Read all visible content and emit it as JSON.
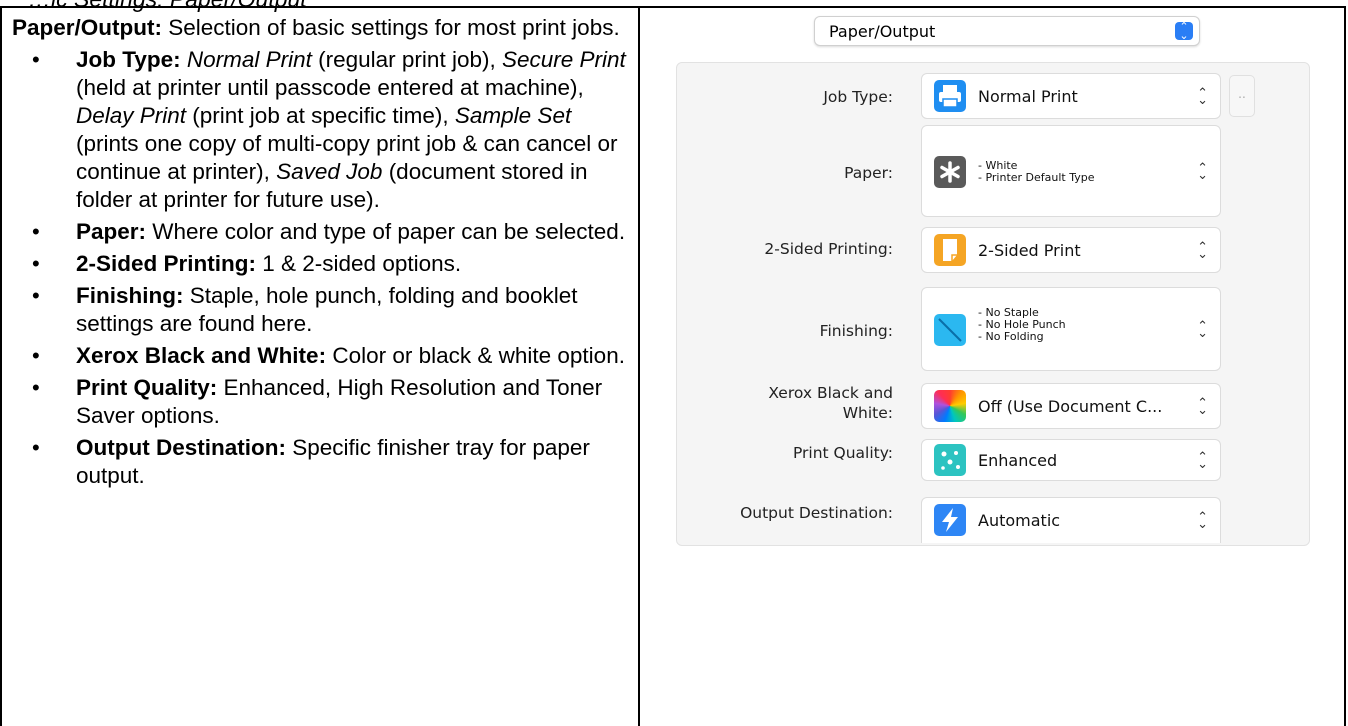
{
  "heading_fragment": "…ic Settings: Paper/Output",
  "left": {
    "intro_bold": "Paper/Output:",
    "intro_text": " Selection of basic settings for most print jobs.",
    "bullets": [
      {
        "term": "Job Type:",
        "parts": [
          {
            "i": "Normal Print"
          },
          {
            "t": " (regular print job), "
          },
          {
            "i": "Secure Print"
          },
          {
            "t": " (held at printer until passcode entered at machine), "
          },
          {
            "i": "Delay Print"
          },
          {
            "t": " (print job at specific time), "
          },
          {
            "i": "Sample Set"
          },
          {
            "t": " (prints one copy of multi-copy print job & can cancel or continue at printer), "
          },
          {
            "i": "Saved Job"
          },
          {
            "t": " (document stored in folder at printer for future use)."
          }
        ]
      },
      {
        "term": "Paper:",
        "parts": [
          {
            "t": " Where color and type of paper can be selected."
          }
        ]
      },
      {
        "term": "2-Sided Printing:",
        "parts": [
          {
            "t": " 1 & 2-sided options."
          }
        ]
      },
      {
        "term": "Finishing:",
        "parts": [
          {
            "t": " Staple, hole punch, folding and booklet settings are found here."
          }
        ]
      },
      {
        "term": "Xerox Black and White:",
        "parts": [
          {
            "t": " Color or black & white option."
          }
        ]
      },
      {
        "term": "Print Quality:",
        "parts": [
          {
            "t": " Enhanced, High Resolution and Toner Saver options."
          }
        ]
      },
      {
        "term": "Output Destination:",
        "parts": [
          {
            "t": " Specific finisher tray for paper output."
          }
        ]
      }
    ]
  },
  "dialog": {
    "section_select": "Paper/Output",
    "job_type_label": "Job Type:",
    "job_type_value": "Normal Print",
    "job_type_more": "..",
    "paper_label": "Paper:",
    "paper_line1": "- White",
    "paper_line2": "- Printer Default Type",
    "sided_label": "2-Sided Printing:",
    "sided_value": "2-Sided Print",
    "finishing_label": "Finishing:",
    "finishing_line1": "- No Staple",
    "finishing_line2": "- No Hole Punch",
    "finishing_line3": "- No Folding",
    "bw_label_1": "Xerox Black and",
    "bw_label_2": "White:",
    "bw_value": "Off (Use Document C...",
    "quality_label": "Print Quality:",
    "quality_value": "Enhanced",
    "output_label": "Output Destination:",
    "output_value": "Automatic",
    "colors": {
      "printer_icon": "#1f8ef1",
      "paper_icon": "#5a5a5a",
      "sided_icon": "#f5a524",
      "finishing_icon": "#2bb8f0",
      "quality_icon": "#2cc3c1",
      "output_icon": "#2e86f5",
      "select_accent": "#2a7ef5"
    }
  }
}
